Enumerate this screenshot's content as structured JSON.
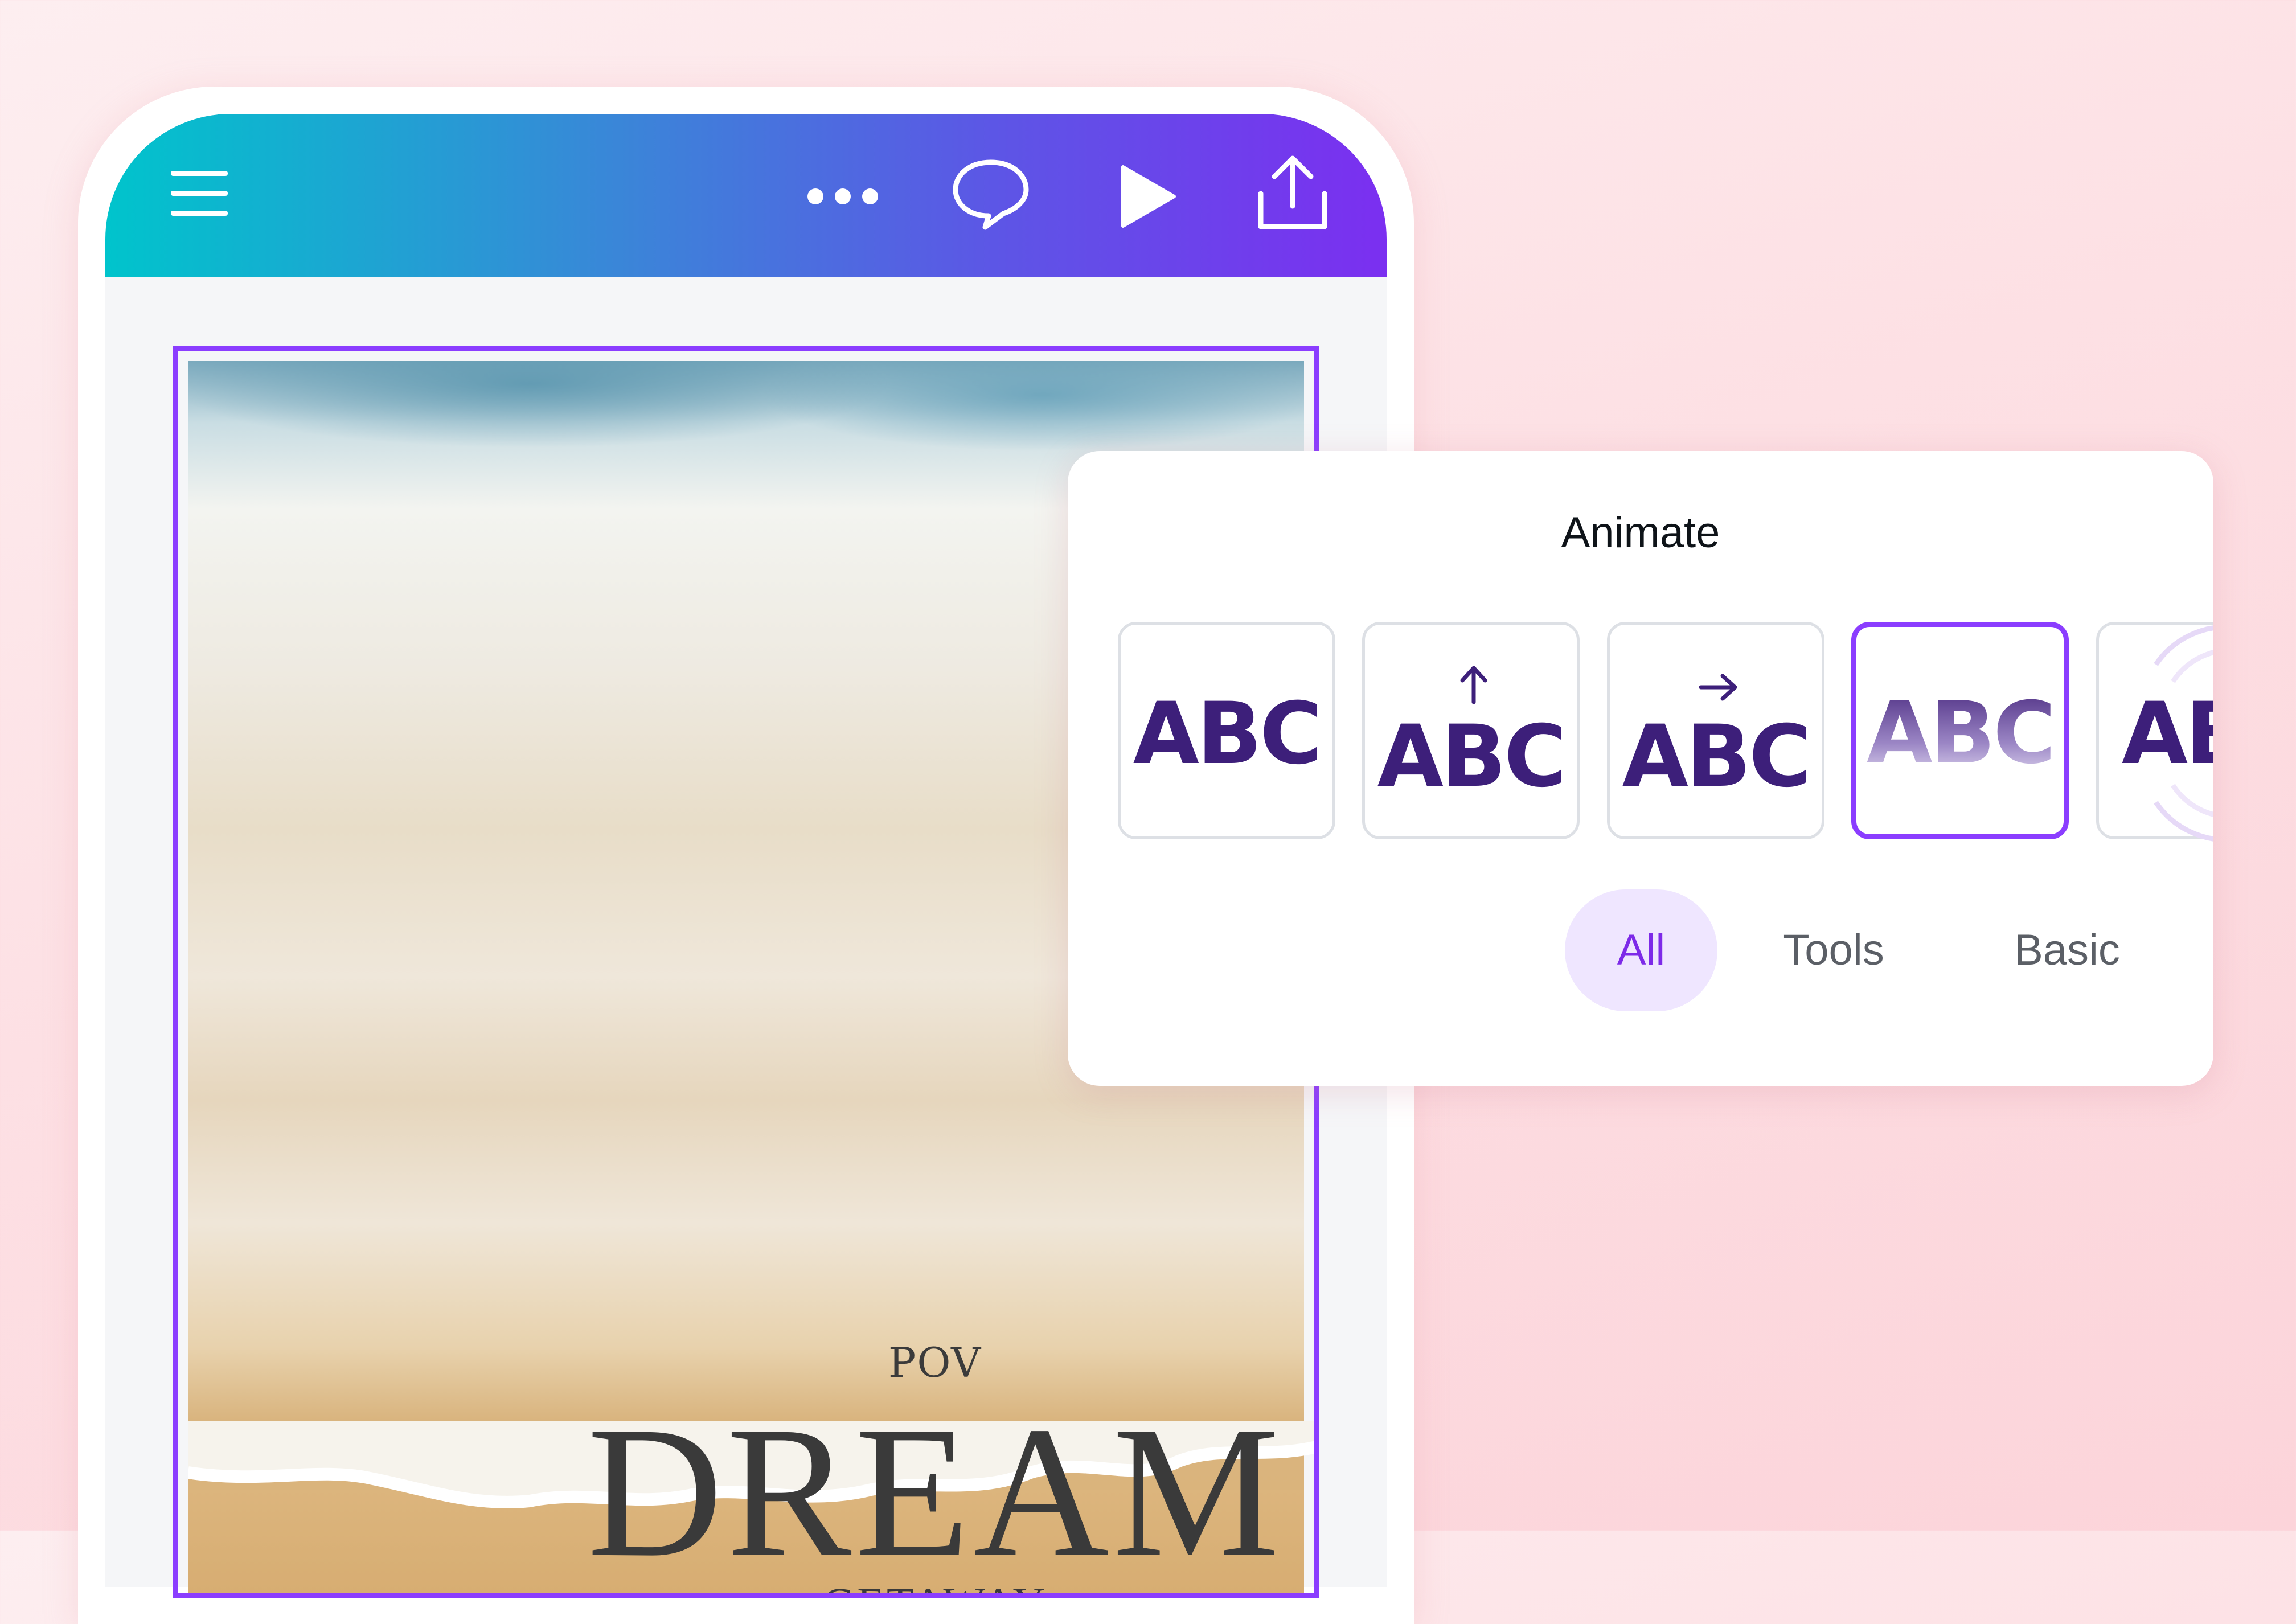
{
  "toolbar": {
    "icons": [
      "menu-icon",
      "more-icon",
      "comment-icon",
      "play-icon",
      "share-icon"
    ],
    "gradient": [
      "#00c4cc",
      "#7b2ff0"
    ]
  },
  "design": {
    "line1": "POV",
    "line2": "DREAM",
    "line3": "GETAWAY"
  },
  "animate_panel": {
    "title": "Animate",
    "tiles": [
      {
        "label": "ABC",
        "selected": false
      },
      {
        "label": "ABC",
        "selected": false,
        "icon": "arrow-up-icon"
      },
      {
        "label": "ABC",
        "selected": false,
        "icon": "arrow-right-icon"
      },
      {
        "label": "ABC",
        "selected": true
      },
      {
        "label": "AB",
        "selected": false
      }
    ],
    "tabs": [
      {
        "label": "All",
        "active": true
      },
      {
        "label": "Tools",
        "active": false
      },
      {
        "label": "Basic",
        "active": false
      }
    ]
  },
  "colors": {
    "accent": "#8b3dff",
    "tile_text": "#3d1f7a",
    "active_tab_bg": "#efe6ff"
  }
}
